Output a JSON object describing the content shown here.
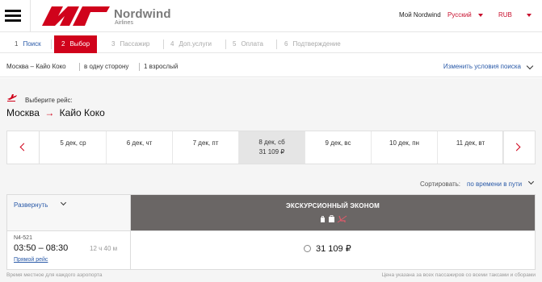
{
  "header": {
    "brand_name": "Nordwind",
    "brand_sub": "Airlines",
    "account_link": "Мой Nordwind",
    "language": "Русский",
    "currency": "RUB"
  },
  "steps": [
    {
      "num": "1",
      "label": "Поиск",
      "state": "done"
    },
    {
      "num": "2",
      "label": "Выбор",
      "state": "active"
    },
    {
      "num": "3",
      "label": "Пассажир",
      "state": "todo"
    },
    {
      "num": "4",
      "label": "Доп.услуги",
      "state": "todo"
    },
    {
      "num": "5",
      "label": "Оплата",
      "state": "todo"
    },
    {
      "num": "6",
      "label": "Подтверждение",
      "state": "todo"
    }
  ],
  "trip": {
    "route": "Москва – Кайо Коко",
    "direction": "в одну сторону",
    "passengers": "1 взрослый",
    "change_label": "Изменить условия поиска"
  },
  "selection": {
    "prompt": "Выберите рейс:",
    "from": "Москва",
    "arrow": "→",
    "to": "Кайо Коко"
  },
  "dates": [
    {
      "label": "5 дек, ср",
      "price": ""
    },
    {
      "label": "6 дек, чт",
      "price": ""
    },
    {
      "label": "7 дек, пт",
      "price": ""
    },
    {
      "label": "8 дек, сб",
      "price": "31 109 ₽",
      "selected": true
    },
    {
      "label": "9 дек, вс",
      "price": ""
    },
    {
      "label": "10 дек, пн",
      "price": ""
    },
    {
      "label": "11 дек, вт",
      "price": ""
    }
  ],
  "sort": {
    "label": "Сортировать:",
    "value": "по времени в пути"
  },
  "results": {
    "expand_label": "Развернуть",
    "fare_title": "ЭКСКУРСИОННЫЙ ЭКОНОМ",
    "fare_icons": [
      "bag-icon",
      "baggage-icon",
      "seat-icon"
    ],
    "flight_number": "N4-521",
    "times": "03:50 – 08:30",
    "duration": "12 ч 40 м",
    "direct_label": "Прямой рейс",
    "price": "31 109 ₽"
  },
  "footer": {
    "left": "Время местное для каждого аэропорта",
    "right": "Цена указана за всех пассажиров со всеми таксами и сборами"
  },
  "colors": {
    "brand_red": "#d0021b",
    "link_blue": "#2a5aa8",
    "fare_header": "#6a6665"
  }
}
